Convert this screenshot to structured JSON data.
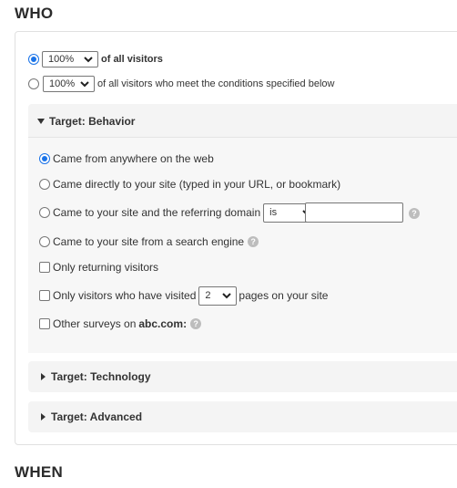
{
  "who_heading": "WHO",
  "when_heading": "WHEN",
  "audience": {
    "option1": {
      "percent": "100%",
      "label": "of all visitors",
      "selected": true
    },
    "option2": {
      "percent": "100%",
      "label": "of all visitors who meet the conditions specified below",
      "selected": false
    }
  },
  "behavior": {
    "title": "Target: Behavior",
    "came_anywhere": "Came from anywhere on the web",
    "came_directly": "Came directly to your site (typed in your URL, or bookmark)",
    "came_referring": "Came to your site and the referring domain",
    "referring_op": "is",
    "referring_value": "",
    "came_search": "Came to your site from a search engine",
    "returning": "Only returning visitors",
    "visited_prefix": "Only visitors who have visited",
    "visited_count": "2",
    "visited_suffix": "pages on your site",
    "other_surveys_prefix": "Other surveys on",
    "other_surveys_domain": "abc.com",
    "other_surveys_suffix": ":"
  },
  "technology": {
    "title": "Target: Technology"
  },
  "advanced": {
    "title": "Target: Advanced"
  },
  "colors": {
    "accent": "#1a73e8",
    "panel": "#f4f4f4",
    "help": "#bdbdbd"
  }
}
